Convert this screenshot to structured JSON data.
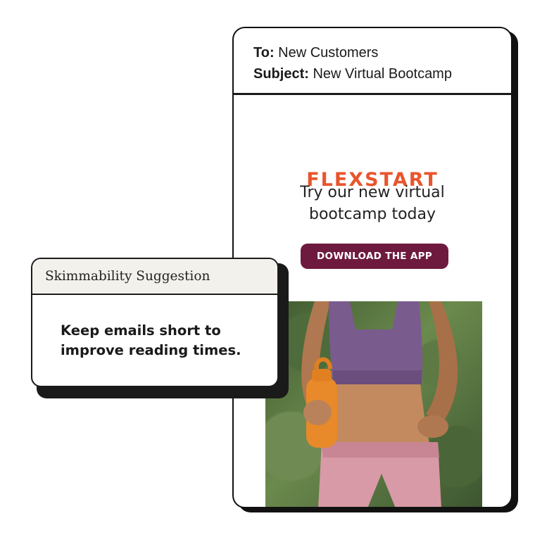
{
  "email": {
    "to_label": "To:",
    "to_value": "New Customers",
    "subject_label": "Subject:",
    "subject_value": "New Virtual Bootcamp",
    "brand": "FLEXSTART",
    "headline_line1": "Try our new virtual",
    "headline_line2": "bootcamp today",
    "cta_label": "DOWNLOAD THE APP"
  },
  "suggestion": {
    "title": "Skimmability Suggestion",
    "body_line1": "Keep emails short to",
    "body_line2": "improve reading times."
  },
  "colors": {
    "brand": "#e8552c",
    "cta_bg": "#6e1a3e",
    "card_border": "#111111",
    "suggestion_header_bg": "#f3f1ec"
  }
}
